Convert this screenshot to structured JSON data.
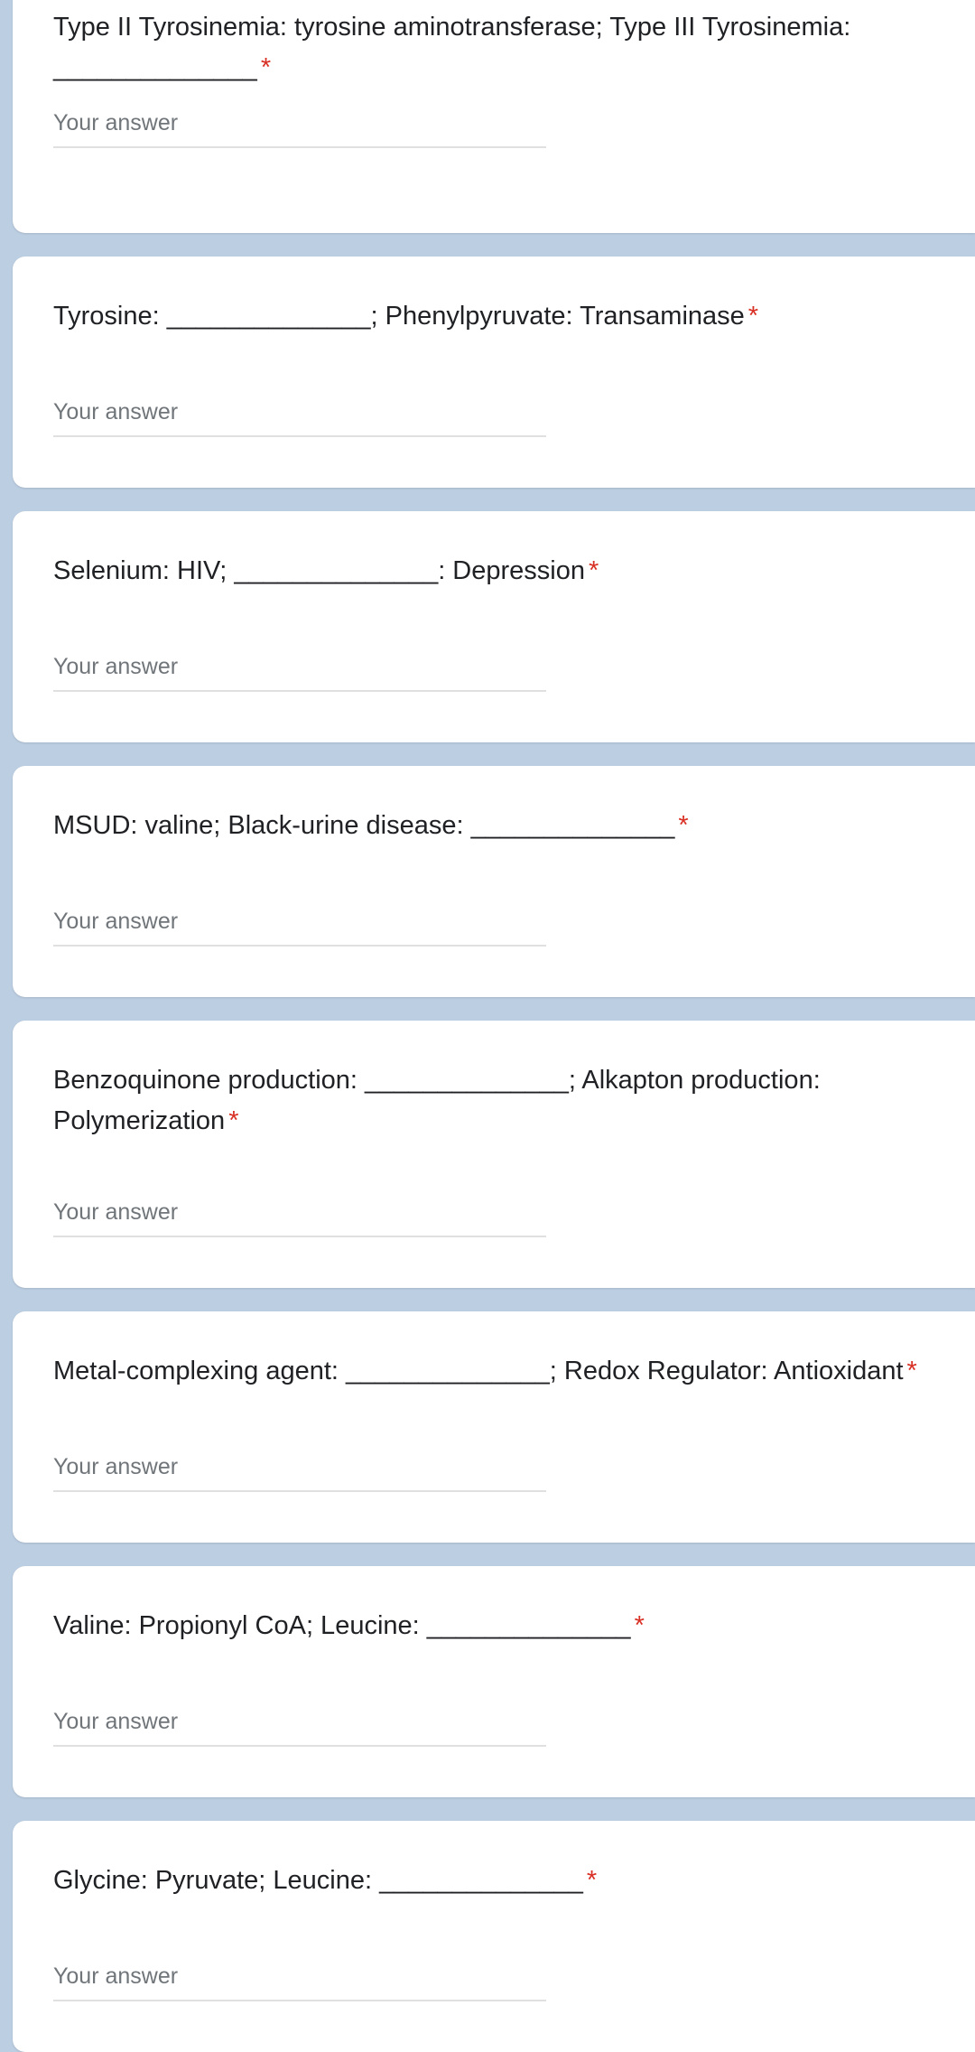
{
  "colors": {
    "background": "#bccee2",
    "card": "#ffffff",
    "required": "#d93025",
    "placeholder": "#70757a"
  },
  "questions": [
    {
      "title": "Type II Tyrosinemia: tyrosine aminotransferase; Type III Tyrosinemia: ______________",
      "required_mark": "*",
      "placeholder": "Your answer"
    },
    {
      "title": "Tyrosine: ______________; Phenylpyruvate: Transaminase",
      "required_mark": "*",
      "placeholder": "Your answer"
    },
    {
      "title": "Selenium: HIV; ______________: Depression",
      "required_mark": "*",
      "placeholder": "Your answer"
    },
    {
      "title": "MSUD: valine; Black-urine disease: ______________",
      "required_mark": "*",
      "placeholder": "Your answer"
    },
    {
      "title": "Benzoquinone production: ______________; Alkapton production: Polymerization",
      "required_mark": "*",
      "placeholder": "Your answer"
    },
    {
      "title": "Metal-complexing agent: ______________; Redox Regulator: Antioxidant",
      "required_mark": "*",
      "placeholder": "Your answer"
    },
    {
      "title": "Valine: Propionyl CoA; Leucine: ______________",
      "required_mark": "*",
      "placeholder": "Your answer"
    },
    {
      "title": "Glycine: Pyruvate; Leucine: ______________",
      "required_mark": "*",
      "placeholder": "Your answer"
    }
  ]
}
